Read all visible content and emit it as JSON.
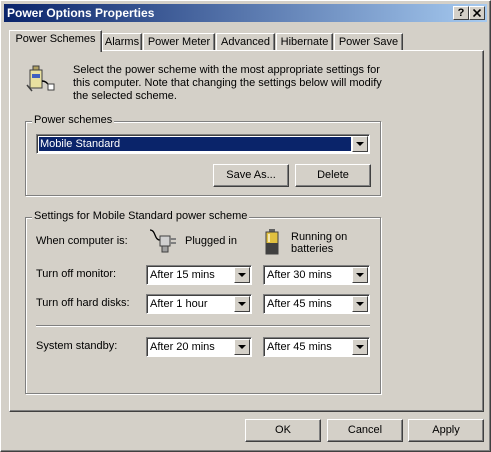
{
  "window": {
    "title": "Power Options Properties",
    "help_label": "?",
    "close_label": "X"
  },
  "tabs": [
    {
      "label": "Power Schemes",
      "active": true
    },
    {
      "label": "Alarms"
    },
    {
      "label": "Power Meter"
    },
    {
      "label": "Advanced"
    },
    {
      "label": "Hibernate"
    },
    {
      "label": "Power Save"
    }
  ],
  "intro": {
    "text": "Select the power scheme with the most appropriate settings for this computer. Note that changing the settings below will modify the selected scheme.",
    "icon": "power-scheme-icon"
  },
  "schemes": {
    "group_title": "Power schemes",
    "selected": "Mobile Standard",
    "save_as_label": "Save As...",
    "delete_label": "Delete"
  },
  "settings": {
    "group_title": "Settings for Mobile Standard power scheme",
    "when_label": "When computer is:",
    "plugged_in_label": "Plugged in",
    "batteries_label": "Running on batteries",
    "rows": [
      {
        "label": "Turn off monitor:",
        "plugged": "After 15 mins",
        "battery": "After 30 mins"
      },
      {
        "label": "Turn off hard disks:",
        "plugged": "After 1 hour",
        "battery": "After 45 mins"
      },
      {
        "label": "System standby:",
        "plugged": "After 20 mins",
        "battery": "After 45 mins"
      }
    ]
  },
  "footer": {
    "ok_label": "OK",
    "cancel_label": "Cancel",
    "apply_label": "Apply"
  },
  "colors": {
    "titlebar_start": "#0a246a",
    "titlebar_end": "#a6caf0",
    "face": "#d4d0c8",
    "selection": "#0a246a"
  }
}
